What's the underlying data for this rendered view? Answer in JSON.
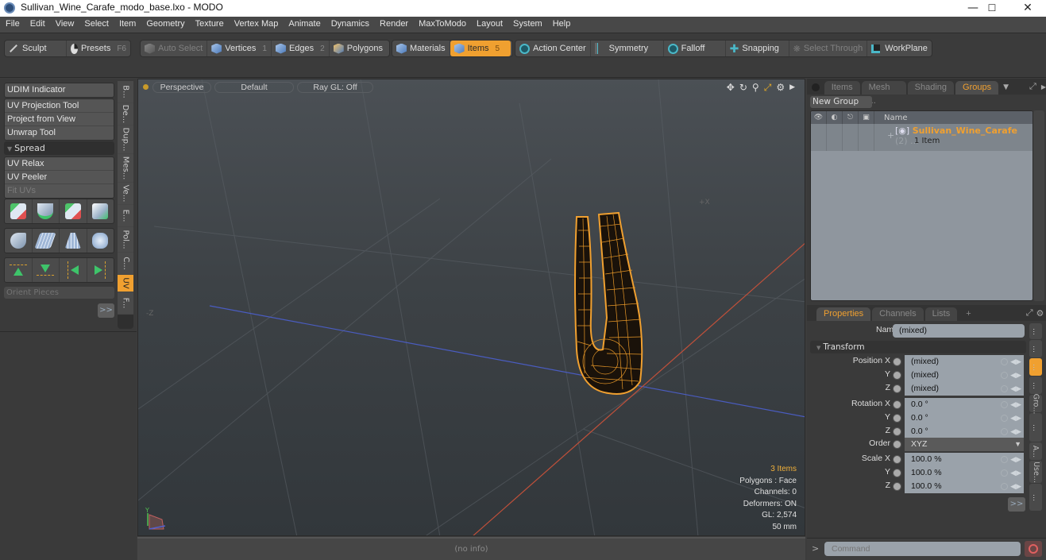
{
  "window": {
    "title": "Sullivan_Wine_Carafe_modo_base.lxo - MODO",
    "controls": [
      "minimize",
      "maximize",
      "close"
    ]
  },
  "menu": [
    "File",
    "Edit",
    "View",
    "Select",
    "Item",
    "Geometry",
    "Texture",
    "Vertex Map",
    "Animate",
    "Dynamics",
    "Render",
    "MaxToModo",
    "Layout",
    "System",
    "Help"
  ],
  "toolbar": {
    "sculpt": "Sculpt",
    "presets": "Presets",
    "presets_key": "F6",
    "auto_select": "Auto Select",
    "vertices": "Vertices",
    "vertices_key": "1",
    "edges": "Edges",
    "edges_key": "2",
    "polygons": "Polygons",
    "materials": "Materials",
    "items": "Items",
    "items_key": "5",
    "action_center": "Action Center",
    "symmetry": "Symmetry",
    "falloff": "Falloff",
    "snapping": "Snapping",
    "select_through": "Select Through",
    "workplane": "WorkPlane"
  },
  "left_panel": {
    "udim": "UDIM Indicator",
    "group1": [
      "UV Projection Tool",
      "Project from View",
      "Unwrap Tool"
    ],
    "spread": "Spread",
    "group2": [
      "UV Relax",
      "UV Peeler",
      "Fit UVs"
    ],
    "orient": "Orient Pieces",
    "more": ">>",
    "vtabs": [
      "B...",
      "De...",
      "Dup...",
      "Mes...",
      "Ve...",
      "E...",
      "Pol...",
      "C...",
      "UV",
      "F..."
    ],
    "active_vtab": "UV"
  },
  "viewport": {
    "view": "Perspective",
    "shading": "Default",
    "raygl": "Ray GL: Off",
    "axis_x": "+X",
    "axis_z": "-Z",
    "info": {
      "items": "3 Items",
      "polygons": "Polygons : Face",
      "channels": "Channels: 0",
      "deformers": "Deformers: ON",
      "gl": "GL: 2,574",
      "scale": "50 mm"
    },
    "gizmo_y": "Y"
  },
  "status": "(no info)",
  "groups_panel": {
    "tabs": [
      "Items",
      "Mesh ...",
      "Shading",
      "Groups"
    ],
    "active_tab": "Groups",
    "new_group": "New Group",
    "name_header": "Name",
    "group_name": "Sullivan_Wine_Carafe",
    "group_count": "(2) ...",
    "group_sub": "1 Item"
  },
  "properties_panel": {
    "tabs": [
      "Properties",
      "Channels",
      "Lists",
      "+"
    ],
    "active_tab": "Properties",
    "name_label": "Name",
    "name_value": "(mixed)",
    "transform": "Transform",
    "rows": [
      {
        "label": "Position X",
        "value": "(mixed)"
      },
      {
        "label": "Y",
        "value": "(mixed)"
      },
      {
        "label": "Z",
        "value": "(mixed)"
      },
      {
        "label": "Rotation X",
        "value": "0.0 °"
      },
      {
        "label": "Y",
        "value": "0.0 °"
      },
      {
        "label": "Z",
        "value": "0.0 °"
      },
      {
        "label": "Order",
        "value": "XYZ"
      },
      {
        "label": "Scale X",
        "value": "100.0 %"
      },
      {
        "label": "Y",
        "value": "100.0 %"
      },
      {
        "label": "Z",
        "value": "100.0 %"
      }
    ],
    "more": ">>",
    "vtabs": [
      "...",
      "...",
      "...",
      "...",
      "Gro...",
      "...",
      "A...",
      "Use...",
      "..."
    ]
  },
  "command": {
    "prompt": ">",
    "placeholder": "Command"
  },
  "colors": {
    "accent": "#f0a030",
    "x_axis": "#c0503a",
    "z_axis": "#4a5cc0"
  }
}
